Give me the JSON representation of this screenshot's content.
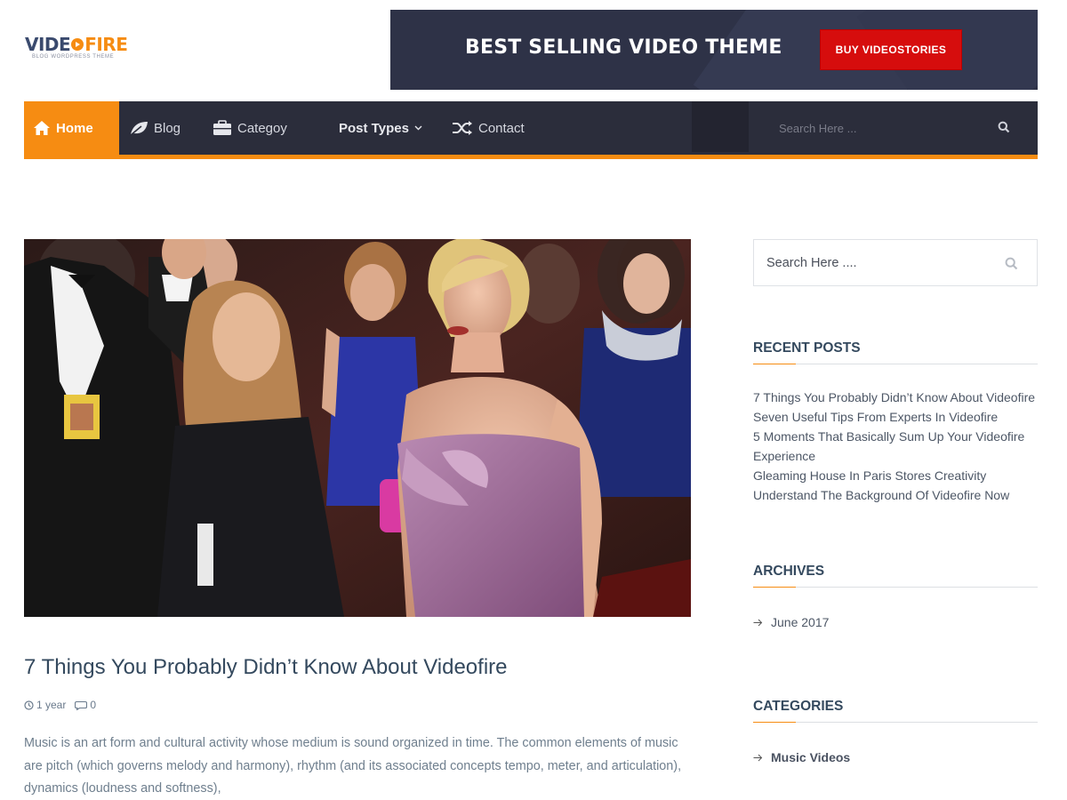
{
  "logo": {
    "word1": "VIDE",
    "word2": "FIRE",
    "tagline": "BLOG WORDPRESS THEME"
  },
  "banner": {
    "title": "BEST SELLING VIDEO THEME",
    "button": "BUY VIDEOSTORIES"
  },
  "nav": {
    "items": [
      {
        "label": "Home",
        "icon": "home-icon"
      },
      {
        "label": "Blog",
        "icon": "leaf-icon"
      },
      {
        "label": "Categoy",
        "icon": "briefcase-icon"
      },
      {
        "label": "Post Types",
        "icon": "chevron-down-icon"
      },
      {
        "label": "Contact",
        "icon": "shuffle-icon"
      }
    ],
    "search_placeholder": "Search Here ..."
  },
  "post": {
    "title": "7 Things You Probably Didn’t Know About Videofire",
    "time": "1 year",
    "comments": "0",
    "excerpt": "Music is an art form and cultural activity whose medium is sound organized in time. The common elements of music are pitch (which governs melody and harmony), rhythm (and its associated concepts tempo, meter, and articulation), dynamics (loudness and softness),"
  },
  "sidebar": {
    "search_placeholder": "Search Here ....",
    "recent_title": "RECENT POSTS",
    "recent_posts": [
      "7 Things You Probably Didn’t Know About Videofire",
      "Seven Useful Tips From Experts In Videofire",
      "5 Moments That Basically Sum Up Your Videofire Experience",
      "Gleaming House In Paris Stores Creativity",
      "Understand The Background Of Videofire Now"
    ],
    "archives_title": "ARCHIVES",
    "archives": [
      "June 2017"
    ],
    "categories_title": "CATEGORIES",
    "categories": [
      "Music Videos"
    ]
  },
  "colors": {
    "accent": "#f68c12",
    "nav_bg": "#2b2d3b",
    "banner_bg": "#2e3247",
    "button_red": "#d60d0d"
  }
}
